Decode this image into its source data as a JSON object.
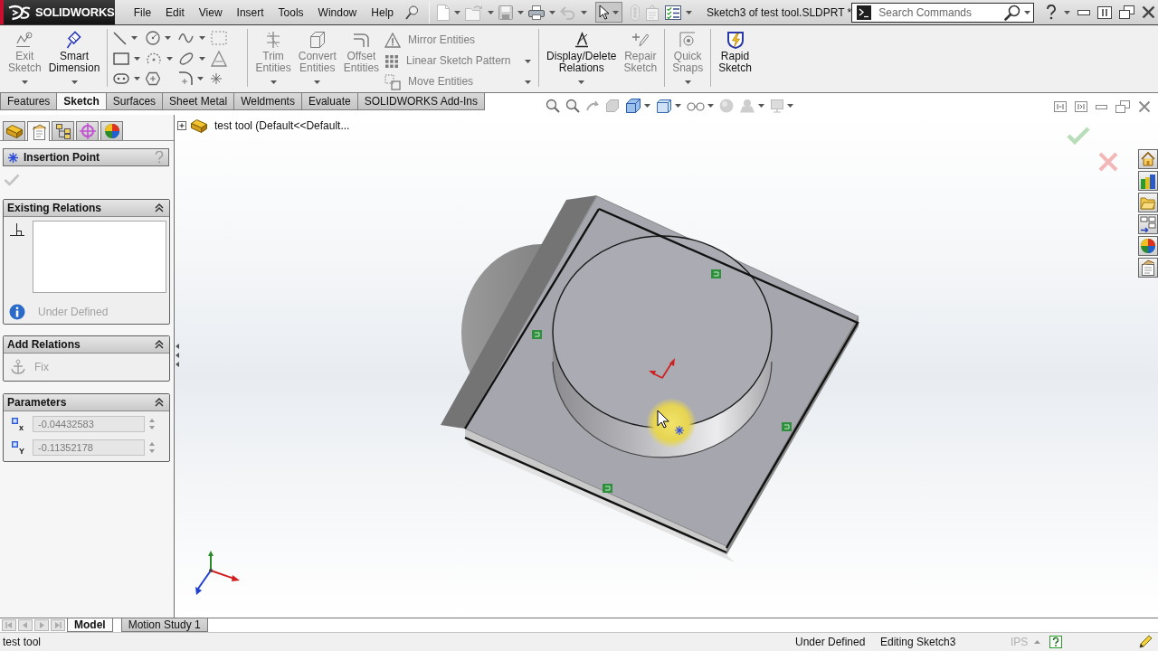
{
  "title_bar": {
    "logo": "SOLIDWORKS",
    "menu": [
      "File",
      "Edit",
      "View",
      "Insert",
      "Tools",
      "Window",
      "Help"
    ],
    "document_title": "Sketch3 of test tool.SLDPRT *",
    "search": {
      "placeholder": "Search Commands"
    }
  },
  "command_manager": {
    "sketch_buttons": [
      {
        "label": "Exit Sketch",
        "disabled": true,
        "dropdown": true
      },
      {
        "label": "Smart Dimension",
        "disabled": false,
        "dropdown": true
      }
    ],
    "edit_buttons": [
      {
        "label": "Trim Entities",
        "disabled": true,
        "dropdown": true
      },
      {
        "label": "Convert Entities",
        "disabled": true,
        "dropdown": true
      },
      {
        "label": "Offset Entities",
        "disabled": true,
        "dropdown": false
      }
    ],
    "edit_list": [
      {
        "label": "Mirror Entities",
        "disabled": true,
        "dropdown": false
      },
      {
        "label": "Linear Sketch Pattern",
        "disabled": true,
        "dropdown": true
      },
      {
        "label": "Move Entities",
        "disabled": true,
        "dropdown": true
      }
    ],
    "relation_buttons": [
      {
        "label": "Display/Delete Relations",
        "disabled": false,
        "dropdown": true
      },
      {
        "label": "Repair Sketch",
        "disabled": true,
        "dropdown": false
      }
    ],
    "snap_buttons": [
      {
        "label": "Quick Snaps",
        "disabled": true,
        "dropdown": true
      }
    ],
    "rapid_buttons": [
      {
        "label": "Rapid Sketch",
        "disabled": false,
        "dropdown": false
      }
    ]
  },
  "command_tabs": [
    {
      "label": "Features",
      "selected": false
    },
    {
      "label": "Sketch",
      "selected": true
    },
    {
      "label": "Surfaces",
      "selected": false
    },
    {
      "label": "Sheet Metal",
      "selected": false
    },
    {
      "label": "Weldments",
      "selected": false
    },
    {
      "label": "Evaluate",
      "selected": false
    },
    {
      "label": "SOLIDWORKS Add-Ins",
      "selected": false
    }
  ],
  "left_panel": {
    "manager_tabs": [
      {
        "kind": "feature_manager",
        "selected": false
      },
      {
        "kind": "property_manager",
        "selected": true
      },
      {
        "kind": "configuration_manager",
        "selected": false
      },
      {
        "kind": "dimxpert_manager",
        "selected": false
      },
      {
        "kind": "display_manager",
        "selected": false
      }
    ],
    "property_manager": {
      "title": "Insertion Point",
      "ok_button": {
        "disabled": true
      },
      "groups": [
        {
          "kind": "relations",
          "title": "Existing Relations",
          "expanded": true,
          "status": "Under Defined"
        },
        {
          "kind": "add_relations",
          "title": "Add Relations",
          "expanded": true,
          "items": [
            {
              "label": "Fix",
              "disabled": true
            }
          ]
        },
        {
          "kind": "parameters",
          "title": "Parameters",
          "expanded": true,
          "fields": [
            {
              "axis": "x",
              "value": "-0.04432583",
              "disabled": true
            },
            {
              "axis": "Y",
              "value": "-0.11352178",
              "disabled": true
            }
          ]
        }
      ]
    }
  },
  "graphics_area": {
    "feature_tree": {
      "label": "test tool (Default<<Default...",
      "expanded": false
    }
  },
  "bottom_tabs": [
    {
      "label": "Model",
      "selected": true
    },
    {
      "label": "Motion Study 1",
      "selected": false
    }
  ],
  "status_bar": {
    "document": "test tool",
    "sketch_status": "Under Defined",
    "mode": "Editing Sketch3",
    "units": "IPS"
  }
}
